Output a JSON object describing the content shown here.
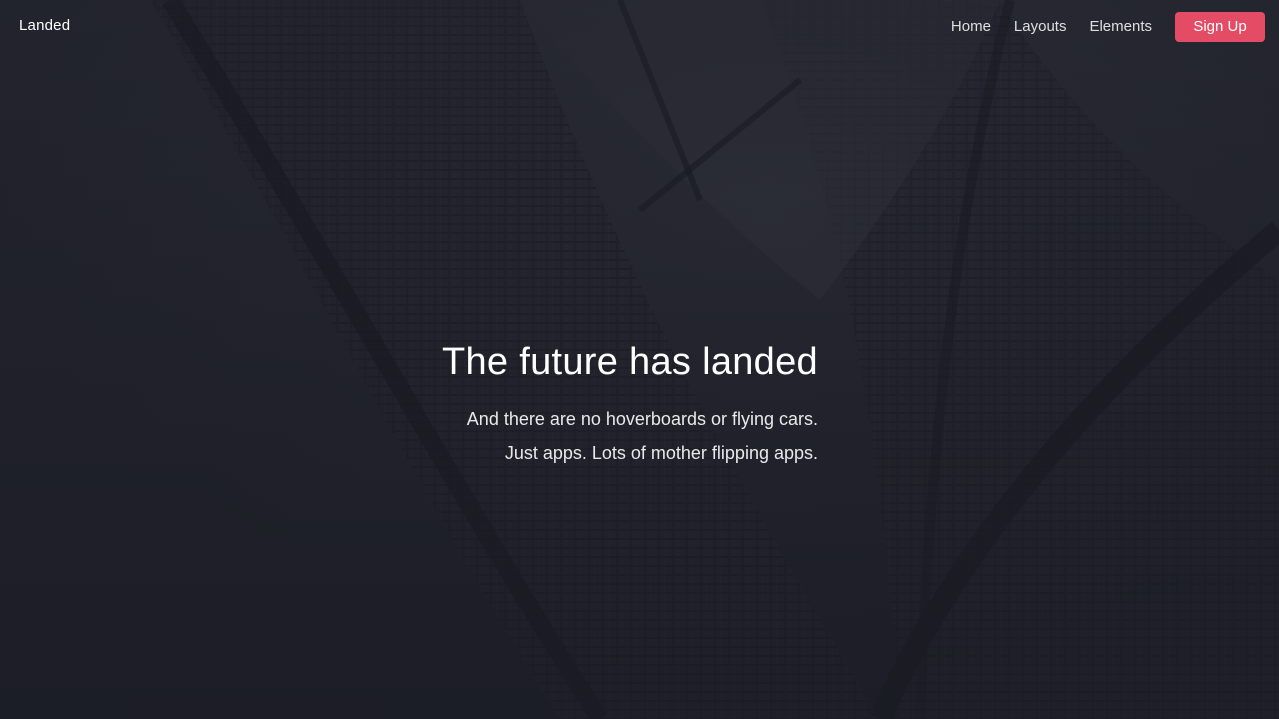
{
  "header": {
    "logo": "Landed",
    "nav": {
      "home": "Home",
      "layouts": "Layouts",
      "elements": "Elements",
      "signup": "Sign Up"
    }
  },
  "banner": {
    "title": "The future has landed",
    "line1": "And there are no hoverboards or flying cars.",
    "line2": "Just apps. Lots of mother flipping apps."
  },
  "colors": {
    "accent": "#e44c65",
    "background": "#1c1d26"
  }
}
